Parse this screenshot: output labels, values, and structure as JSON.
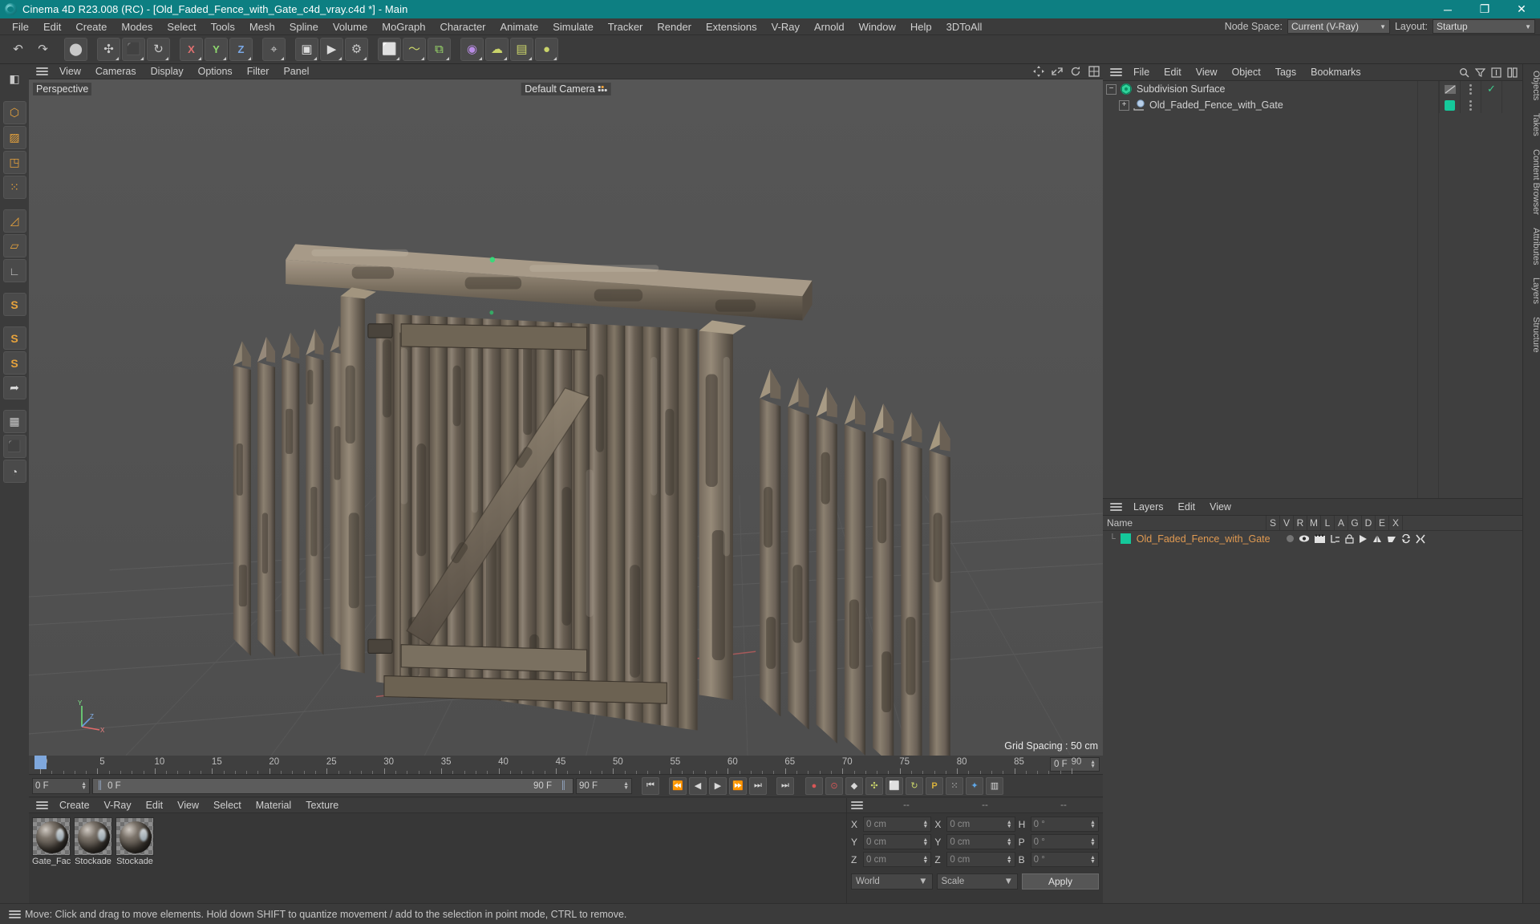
{
  "window": {
    "title": "Cinema 4D R23.008 (RC) - [Old_Faded_Fence_with_Gate_c4d_vray.c4d *] - Main",
    "minimize": "─",
    "maximize": "❐",
    "close": "✕"
  },
  "menubar": {
    "items": [
      "File",
      "Edit",
      "Create",
      "Modes",
      "Select",
      "Tools",
      "Mesh",
      "Spline",
      "Volume",
      "MoGraph",
      "Character",
      "Animate",
      "Simulate",
      "Tracker",
      "Render",
      "Extensions",
      "V-Ray",
      "Arnold",
      "Window",
      "Help",
      "3DToAll"
    ],
    "node_space_label": "Node Space:",
    "node_space_value": "Current (V-Ray)",
    "layout_label": "Layout:",
    "layout_value": "Startup"
  },
  "toolbar": {
    "items": [
      {
        "name": "undo-button",
        "glyph": "↶"
      },
      {
        "name": "redo-button",
        "glyph": "↷"
      },
      {
        "name": "live-selection-tool",
        "glyph": "⬤"
      },
      {
        "name": "move-tool",
        "glyph": "✣"
      },
      {
        "name": "scale-tool",
        "glyph": "⬛"
      },
      {
        "name": "rotate-tool",
        "glyph": "↻"
      },
      {
        "name": "x-axis-lock",
        "glyph": "X"
      },
      {
        "name": "y-axis-lock",
        "glyph": "Y"
      },
      {
        "name": "z-axis-lock",
        "glyph": "Z"
      },
      {
        "name": "world-object-coordinates",
        "glyph": "⌖"
      },
      {
        "name": "render-view-button",
        "glyph": "▣"
      },
      {
        "name": "render-to-picture-viewer",
        "glyph": "▶"
      },
      {
        "name": "render-settings-button",
        "glyph": "⚙"
      },
      {
        "name": "add-cube-object",
        "glyph": "⬜"
      },
      {
        "name": "add-spline-object",
        "glyph": "〜"
      },
      {
        "name": "add-generator-object",
        "glyph": "⧉"
      },
      {
        "name": "add-bend-deformer",
        "glyph": "◉"
      },
      {
        "name": "add-environment-object",
        "glyph": "☁"
      },
      {
        "name": "add-camera-object",
        "glyph": "▤"
      },
      {
        "name": "add-light-object",
        "glyph": "●"
      }
    ]
  },
  "lefttools": {
    "items": [
      {
        "name": "make-editable-button",
        "glyph": "◧"
      },
      {
        "name": "model-mode-button",
        "glyph": "⬡"
      },
      {
        "name": "texture-mode-button",
        "glyph": "▨"
      },
      {
        "name": "workplane-mode-button",
        "glyph": "◳"
      },
      {
        "name": "points-mode-button",
        "glyph": "⁙"
      },
      {
        "name": "edges-mode-button",
        "glyph": "◿"
      },
      {
        "name": "polygons-mode-button",
        "glyph": "▱"
      },
      {
        "name": "enable-axis-button",
        "glyph": "∟"
      },
      {
        "name": "viewport-solo-single-button",
        "glyph": "S"
      },
      {
        "name": "viewport-solo-hierarchy-button",
        "glyph": "S"
      },
      {
        "name": "viewport-solo-off-button",
        "glyph": "S"
      },
      {
        "name": "enable-snapping-button",
        "glyph": "➦"
      },
      {
        "name": "workplane-lock-button",
        "glyph": "▦"
      },
      {
        "name": "modelling-axis-button",
        "glyph": "⬛"
      },
      {
        "name": "phong-tag-button",
        "glyph": "◔"
      }
    ]
  },
  "viewport": {
    "menu": [
      "View",
      "Cameras",
      "Display",
      "Options",
      "Filter",
      "Panel"
    ],
    "label": "Perspective",
    "camera": "Default Camera",
    "grid_spacing": "Grid Spacing : 50 cm",
    "axis_labels": {
      "x": "X",
      "y": "Y",
      "z": "Z"
    }
  },
  "timeline": {
    "ticks": [
      0,
      5,
      10,
      15,
      20,
      25,
      30,
      35,
      40,
      45,
      50,
      55,
      60,
      65,
      70,
      75,
      80,
      85,
      90
    ],
    "playhead_frame": "0",
    "current_frame_field": "0 F",
    "current_frame_display": "0 F",
    "end_frame_display": "90 F",
    "end_frame_field": "90 F",
    "right_field": "0 F",
    "transport": [
      {
        "name": "go-to-start-button",
        "glyph": "⏮"
      },
      {
        "name": "go-to-previous-keyframe-button",
        "glyph": "⏪"
      },
      {
        "name": "play-backwards-button",
        "glyph": "◀"
      },
      {
        "name": "play-forwards-button",
        "glyph": "▶"
      },
      {
        "name": "go-to-next-frame-button",
        "glyph": "⏩"
      },
      {
        "name": "go-to-next-keyframe-button",
        "glyph": "⏭"
      },
      {
        "name": "go-to-end-button",
        "glyph": "⏭"
      }
    ],
    "record_tools": [
      {
        "name": "record-active-objects-button",
        "glyph": "●"
      },
      {
        "name": "autokeying-button",
        "glyph": "⊙"
      },
      {
        "name": "keyframe-selection-button",
        "glyph": "◆"
      },
      {
        "name": "position-key-button",
        "glyph": "✣"
      },
      {
        "name": "scale-key-button",
        "glyph": "⬜"
      },
      {
        "name": "rotation-key-button",
        "glyph": "↻"
      },
      {
        "name": "parameter-key-button",
        "glyph": "P"
      },
      {
        "name": "point-level-animation-button",
        "glyph": "⁙"
      }
    ]
  },
  "material_manager": {
    "menu": [
      "Create",
      "V-Ray",
      "Edit",
      "View",
      "Select",
      "Material",
      "Texture"
    ],
    "materials": [
      {
        "name": "Gate_Fac"
      },
      {
        "name": "Stockade"
      },
      {
        "name": "Stockade"
      }
    ]
  },
  "coordinates": {
    "headers": [
      "--",
      "--",
      "--"
    ],
    "rows": [
      {
        "pos_label": "X",
        "pos_value": "0 cm",
        "size_label": "X",
        "size_value": "0 cm",
        "rot_label": "H",
        "rot_value": "0 °"
      },
      {
        "pos_label": "Y",
        "pos_value": "0 cm",
        "size_label": "Y",
        "size_value": "0 cm",
        "rot_label": "P",
        "rot_value": "0 °"
      },
      {
        "pos_label": "Z",
        "pos_value": "0 cm",
        "size_label": "Z",
        "size_value": "0 cm",
        "rot_label": "B",
        "rot_value": "0 °"
      }
    ],
    "system_select": "World",
    "mode_select": "Scale",
    "apply_label": "Apply"
  },
  "object_manager": {
    "menu": [
      "File",
      "Edit",
      "View",
      "Object",
      "Tags",
      "Bookmarks"
    ],
    "rows": [
      {
        "name": "Subdivision Surface",
        "icon": "subdivision-surface-icon",
        "indent": 0,
        "tag_color": "",
        "has_check": true
      },
      {
        "name": "Old_Faded_Fence_with_Gate",
        "icon": "polygon-object-icon",
        "indent": 1,
        "tag_color": "#15c89b",
        "has_check": false
      }
    ]
  },
  "layer_manager": {
    "menu": [
      "Layers",
      "Edit",
      "View"
    ],
    "name_header": "Name",
    "columns": [
      "S",
      "V",
      "R",
      "M",
      "L",
      "A",
      "G",
      "D",
      "E",
      "X"
    ],
    "rows": [
      {
        "name": "Old_Faded_Fence_with_Gate",
        "color": "#15c89b"
      }
    ]
  },
  "vertical_tabs": [
    "Objects",
    "Takes",
    "Content Browser",
    "Attributes",
    "Layers",
    "Structure"
  ],
  "statusbar": {
    "message": "Move: Click and drag to move elements. Hold down SHIFT to quantize movement / add to the selection in point mode, CTRL to remove."
  },
  "colors": {
    "accent_teal": "#0d7f82",
    "layer_green": "#15c89b",
    "layer_name_orange": "#e09a52",
    "playhead_blue": "#7fa8dd"
  }
}
